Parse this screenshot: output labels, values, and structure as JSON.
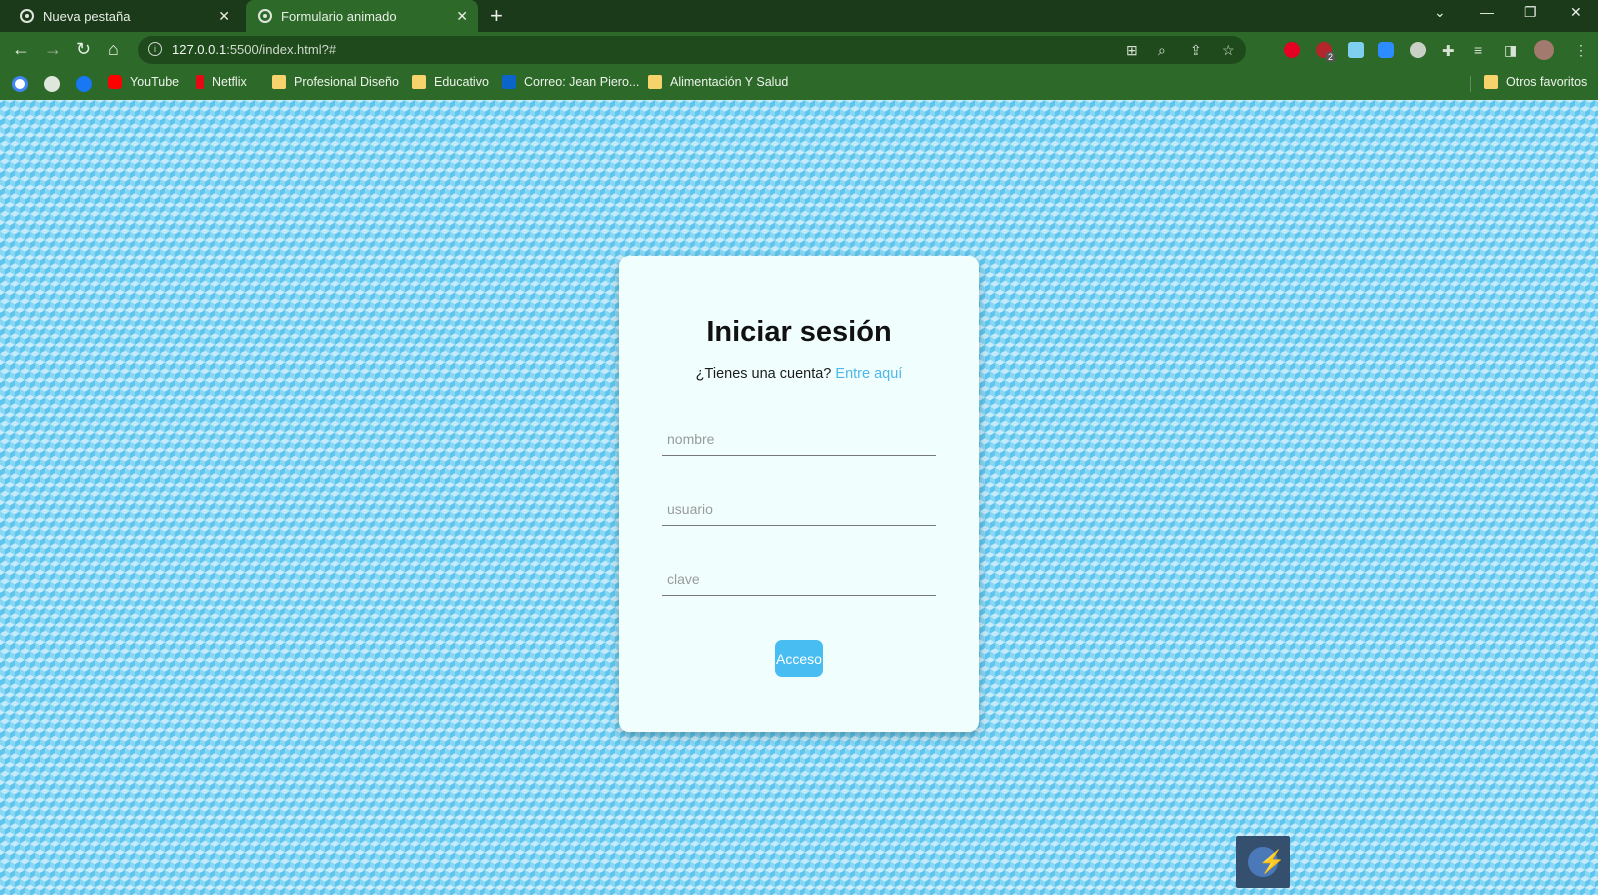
{
  "browser": {
    "tabs": [
      {
        "label": "Nueva pestaña",
        "active": false
      },
      {
        "label": "Formulario animado",
        "active": true
      }
    ],
    "new_tab_symbol": "+",
    "url_host": "127.0.0.1",
    "url_rest": ":5500/index.html?#",
    "bookmarks": [
      {
        "label": "YouTube",
        "icon": "youtube-icon"
      },
      {
        "label": "Netflix",
        "icon": "netflix-icon"
      },
      {
        "label": "Profesional Diseño",
        "icon": "folder-icon"
      },
      {
        "label": "Educativo",
        "icon": "folder-icon"
      },
      {
        "label": "Correo: Jean Piero...",
        "icon": "outlook-icon"
      },
      {
        "label": "Alimentación Y Salud",
        "icon": "folder-icon"
      }
    ],
    "other_bookmarks": "Otros favoritos",
    "extension_badge": "2"
  },
  "form": {
    "title": "Iniciar sesión",
    "prompt": "¿Tienes una cuenta?",
    "link": "Entre aquí",
    "fields": [
      {
        "placeholder": "nombre"
      },
      {
        "placeholder": "usuario"
      },
      {
        "placeholder": "clave"
      }
    ],
    "submit_label": "Acceso"
  },
  "colors": {
    "browser_frame": "#1b3a1a",
    "toolbar": "#2d6a2a",
    "page_pattern": "#5ec6ee",
    "card": "#f0fffe",
    "accent": "#47bdf2",
    "link": "#4fb6ea"
  }
}
